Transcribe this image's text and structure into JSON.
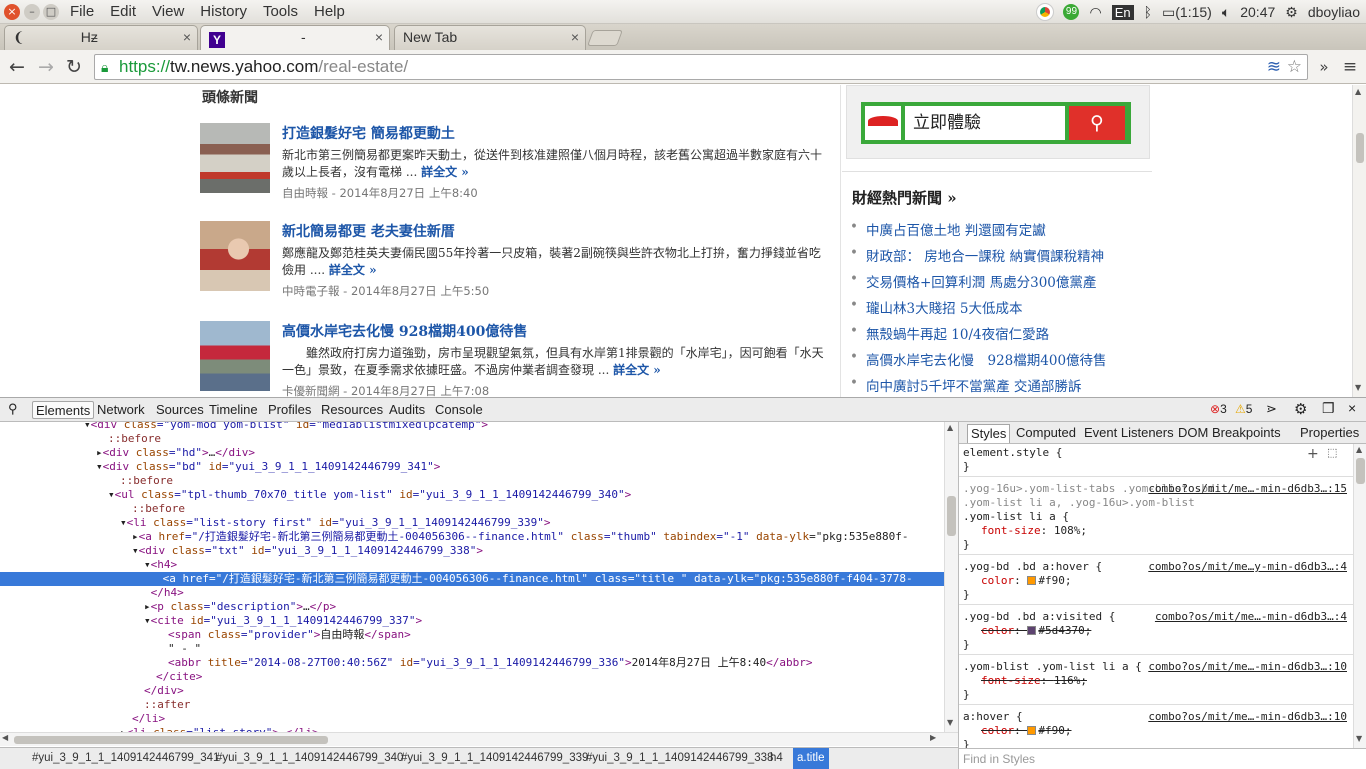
{
  "menubar": {
    "menus": [
      "File",
      "Edit",
      "View",
      "History",
      "Tools",
      "Help"
    ],
    "battery": "(1:15)",
    "clock": "20:47",
    "user": "dboyliao",
    "keyboard": "En"
  },
  "tabs": [
    {
      "label": "Hƶ",
      "close": "×"
    },
    {
      "label": "-",
      "close": "×"
    },
    {
      "label": "New Tab",
      "close": "×"
    }
  ],
  "toolbar": {
    "back_icon": "←",
    "forward_icon": "→",
    "reload_icon": "↻",
    "url_scheme": "https://",
    "url_host": "tw.news.yahoo.com",
    "url_path": "/real-estate/"
  },
  "page": {
    "section_title": "頭條新聞",
    "stories": [
      {
        "title": "打造銀髮好宅 簡易都更動土",
        "desc": "新北市第三例簡易都更案昨天動土，從送件到核准建照僅八個月時程，該老舊公寓超過半數家庭有六十歲以上長者，沒有電梯 ...",
        "more": "詳全文 »",
        "cite": "自由時報 - 2014年8月27日 上午8:40"
      },
      {
        "title": "新北簡易都更 老夫妻住新厝",
        "desc": "鄭應龍及鄭范桂英夫妻倆民國55年拎著一只皮箱，裝著2副碗筷與些許衣物北上打拚，奮力掙錢並省吃儉用 ....",
        "more": "詳全文 »",
        "cite": "中時電子報 - 2014年8月27日 上午5:50"
      },
      {
        "title": "高價水岸宅去化慢 928檔期400億待售",
        "desc": "雖然政府打房力道強勁，房市呈現觀望氣氛，但具有水岸第1排景觀的「水岸宅」，因可飽看「水天一色」景致，在夏季需求依據旺盛。不過房仲業者調查發現 ...",
        "more": "詳全文 »",
        "cite": "卡優新聞網 - 2014年8月27日 上午7:08"
      }
    ],
    "ad_text": "立即體驗",
    "hot_title": "財經熱門新聞 »",
    "hot_items": [
      "中廣占百億土地 判還國有定讞",
      "財政部： 房地合一課稅 納實價課稅精神",
      "交易價格+回算利潤 馬處分300億黨產",
      "瓏山林3大賤招 5大低成本",
      "無殼蝸牛再起 10/4夜宿仁愛路",
      "高價水岸宅去化慢　928檔期400億待售",
      "向中廣討5千坪不當黨產 交通部勝訴"
    ]
  },
  "devtools": {
    "tabs": [
      "Elements",
      "Network",
      "Sources",
      "Timeline",
      "Profiles",
      "Resources",
      "Audits",
      "Console"
    ],
    "errors": "3",
    "warnings": "5",
    "dom_lines": [
      {
        "indent": 7,
        "text": "▾<div class=\"yom-mod yom-blist\" id=\"mediablistmixedlpcatemp\">",
        "sel": false
      },
      {
        "indent": 9,
        "text": "::before",
        "sel": false
      },
      {
        "indent": 8,
        "text": "▸<div class=\"hd\">…</div>",
        "sel": false
      },
      {
        "indent": 8,
        "text": "▾<div class=\"bd\" id=\"yui_3_9_1_1_1409142446799_341\">",
        "sel": false
      },
      {
        "indent": 10,
        "text": "::before",
        "sel": false
      },
      {
        "indent": 9,
        "text": "▾<ul class=\"tpl-thumb_70x70_title yom-list\" id=\"yui_3_9_1_1_1409142446799_340\">",
        "sel": false
      },
      {
        "indent": 11,
        "text": "::before",
        "sel": false
      },
      {
        "indent": 10,
        "text": "▾<li class=\"list-story first\" id=\"yui_3_9_1_1_1409142446799_339\">",
        "sel": false
      },
      {
        "indent": 11,
        "text": "▸<a href=\"/打造銀髮好宅-新北第三例簡易都更動土-004056306--finance.html\" class=\"thumb\" tabindex=\"-1\" data-ylk=\"pkg:535e880f-",
        "sel": false
      },
      {
        "indent": 11,
        "text": "▾<div class=\"txt\" id=\"yui_3_9_1_1_1409142446799_338\">",
        "sel": false
      },
      {
        "indent": 12,
        "text": "▾<h4>",
        "sel": false
      },
      {
        "indent": 13,
        "text": " <a href=\"/打造銀髮好宅-新北第三例簡易都更動土-004056306--finance.html\" class=\"title \" data-ylk=\"pkg:535e880f-f404-3778-",
        "sel": true
      },
      {
        "indent": 12,
        "text": " </h4>",
        "sel": false
      },
      {
        "indent": 12,
        "text": "▸<p class=\"description\">…</p>",
        "sel": false
      },
      {
        "indent": 12,
        "text": "▾<cite id=\"yui_3_9_1_1_1409142446799_337\">",
        "sel": false
      },
      {
        "indent": 14,
        "text": "<span class=\"provider\">自由時報</span>",
        "sel": false
      },
      {
        "indent": 14,
        "text": "\" - \"",
        "sel": false
      },
      {
        "indent": 14,
        "text": "<abbr title=\"2014-08-27T00:40:56Z\" id=\"yui_3_9_1_1_1409142446799_336\">2014年8月27日 上午8:40</abbr>",
        "sel": false
      },
      {
        "indent": 13,
        "text": "</cite>",
        "sel": false
      },
      {
        "indent": 12,
        "text": "</div>",
        "sel": false
      },
      {
        "indent": 12,
        "text": "::after",
        "sel": false
      },
      {
        "indent": 11,
        "text": "</li>",
        "sel": false
      },
      {
        "indent": 10,
        "text": "▸<li class=\"list-story\">…</li>",
        "sel": false
      }
    ],
    "breadcrumbs": [
      {
        "label": "#yui_3_9_1_1_1409142446799_341",
        "sel": false
      },
      {
        "label": "#yui_3_9_1_1_1409142446799_340",
        "sel": false
      },
      {
        "label": "#yui_3_9_1_1_1409142446799_339",
        "sel": false
      },
      {
        "label": "#yui_3_9_1_1_1409142446799_338",
        "sel": false
      },
      {
        "label": "h4",
        "sel": false
      },
      {
        "label": "a.title",
        "sel": true
      }
    ],
    "side_tabs": [
      "Styles",
      "Computed",
      "Event Listeners",
      "DOM Breakpoints",
      "Properties"
    ],
    "rules": [
      {
        "sel": "element.style {",
        "src": "",
        "props": [],
        "close": "}"
      },
      {
        "sel": ".yog-16u>.yom-list-tabs .yom-blist .bd .yom-list li a, .yog-16u>.yom-blist .yom-list li a {",
        "src": "combo?os/mit/me…-min-d6db3…:15",
        "props": [
          {
            "name": "font-size",
            "value": "108%",
            "strike": false,
            "swatch": ""
          }
        ],
        "close": "}"
      },
      {
        "sel": ".yog-bd .bd a:hover {",
        "src": "combo?os/mit/me…y-min-d6db3…:4",
        "props": [
          {
            "name": "color",
            "value": "#f90",
            "strike": false,
            "swatch": "#ff9900"
          }
        ],
        "close": "}"
      },
      {
        "sel": ".yog-bd .bd a:visited {",
        "src": "combo?os/mit/me…-min-d6db3…:4",
        "props": [
          {
            "name": "color",
            "value": "#5d4370",
            "strike": true,
            "swatch": "#5d4370"
          }
        ],
        "close": "}"
      },
      {
        "sel": ".yom-blist .yom-list li a {",
        "src": "combo?os/mit/me…-min-d6db3…:10",
        "props": [
          {
            "name": "font-size",
            "value": "116%",
            "strike": true,
            "swatch": ""
          }
        ],
        "close": "}"
      },
      {
        "sel": "a:hover {",
        "src": "combo?os/mit/me…-min-d6db3…:10",
        "props": [
          {
            "name": "color",
            "value": "#f90",
            "strike": true,
            "swatch": "#ff9900"
          }
        ],
        "close": "}"
      }
    ],
    "find_placeholder": "Find in Styles"
  }
}
